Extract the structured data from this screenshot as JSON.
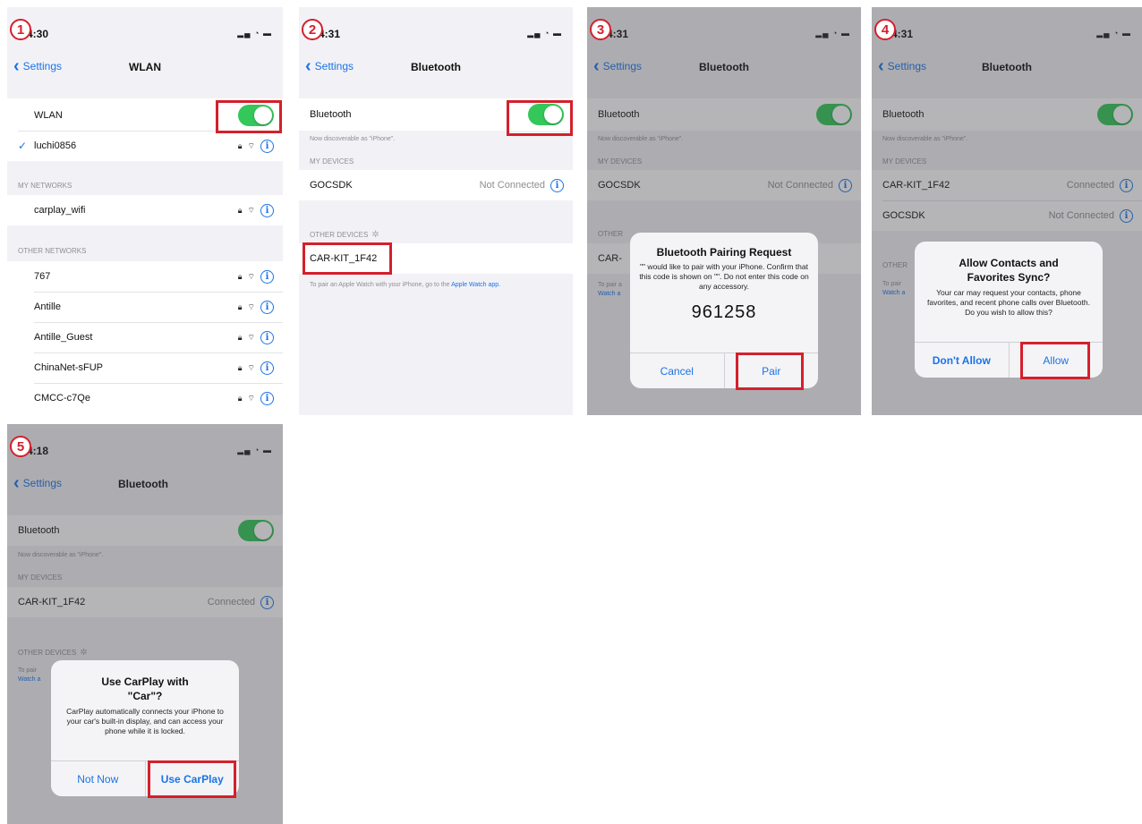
{
  "colors": {
    "accent": "#1a73e8",
    "toggle_on": "#34c759",
    "highlight": "#d4202c"
  },
  "icons": {
    "info": "info-circle-icon",
    "lock": "lock-icon",
    "wifi": "wifi-icon",
    "back": "chevron-left-icon",
    "check": "checkmark-icon",
    "spinner": "spinner-icon"
  },
  "screens": [
    {
      "step": "1",
      "time": "4:30",
      "back_label": "Settings",
      "title": "WLAN",
      "toggle_label": "WLAN",
      "connected_network": "luchi0856",
      "my_networks_header": "MY NETWORKS",
      "my_networks": [
        "carplay_wifi"
      ],
      "other_networks_header": "OTHER NETWORKS",
      "other_networks": [
        "767",
        "Antille",
        "Antille_Guest",
        "ChinaNet-sFUP",
        "CMCC-c7Qe"
      ]
    },
    {
      "step": "2",
      "time": "4:31",
      "back_label": "Settings",
      "title": "Bluetooth",
      "toggle_label": "Bluetooth",
      "discoverable": "Now discoverable as \"iPhone\".",
      "my_devices_header": "MY DEVICES",
      "my_devices": [
        {
          "name": "GOCSDK",
          "status": "Not Connected"
        }
      ],
      "other_devices_header": "OTHER DEVICES",
      "other_devices": [
        "CAR-KIT_1F42"
      ],
      "footnote": "To pair an Apple Watch with your iPhone, go to the",
      "footnote_link": "Apple Watch app."
    },
    {
      "step": "3",
      "time": "4:31",
      "back_label": "Settings",
      "title": "Bluetooth",
      "toggle_label": "Bluetooth",
      "discoverable": "Now discoverable as \"iPhone\".",
      "my_devices_header": "MY DEVICES",
      "my_devices": [
        {
          "name": "GOCSDK",
          "status": "Not Connected"
        }
      ],
      "other_devices_header": "OTHER",
      "other_devices": [
        "CAR-"
      ],
      "footnote": "To pair a",
      "footnote_link": "Watch a",
      "alert": {
        "title": "Bluetooth Pairing Request",
        "message": "\"\" would like to pair with your iPhone. Confirm that this code is shown on \"\". Do not enter this code on any accessory.",
        "code": "961258",
        "cancel": "Cancel",
        "confirm": "Pair"
      }
    },
    {
      "step": "4",
      "time": "4:31",
      "back_label": "Settings",
      "title": "Bluetooth",
      "toggle_label": "Bluetooth",
      "discoverable": "Now discoverable as \"iPhone\".",
      "my_devices_header": "MY DEVICES",
      "my_devices": [
        {
          "name": "CAR-KIT_1F42",
          "status": "Connected"
        },
        {
          "name": "GOCSDK",
          "status": "Not Connected"
        }
      ],
      "other_devices_header": "OTHER",
      "footnote": "To pair",
      "footnote_link": "Watch a",
      "alert": {
        "title": "Allow Contacts and Favorites Sync?",
        "message": "Your car may request your contacts, phone favorites, and recent phone calls over Bluetooth. Do you wish to allow this?",
        "cancel": "Don't Allow",
        "confirm": "Allow"
      }
    },
    {
      "step": "5",
      "time": "4:18",
      "back_label": "Settings",
      "title": "Bluetooth",
      "toggle_label": "Bluetooth",
      "discoverable": "Now discoverable as \"iPhone\".",
      "my_devices_header": "MY DEVICES",
      "my_devices": [
        {
          "name": "CAR-KIT_1F42",
          "status": "Connected"
        }
      ],
      "other_devices_header": "OTHER DEVICES",
      "footnote": "To pair",
      "footnote_link": "Watch a",
      "alert": {
        "title": "Use CarPlay with \"Car\"?",
        "message": "CarPlay automatically connects your iPhone to your car's built-in display, and can access your phone while it is locked.",
        "cancel": "Not Now",
        "confirm": "Use CarPlay"
      }
    }
  ]
}
